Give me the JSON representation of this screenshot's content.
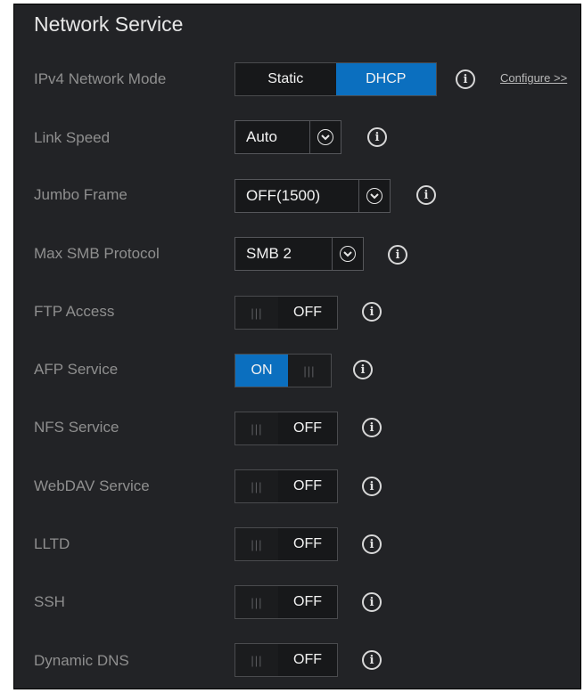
{
  "panel": {
    "title": "Network Service"
  },
  "ipv4": {
    "label": "IPv4 Network Mode",
    "options": [
      "Static",
      "DHCP"
    ],
    "selected": "DHCP",
    "configure_link": "Configure >>"
  },
  "link_speed": {
    "label": "Link Speed",
    "value": "Auto"
  },
  "jumbo_frame": {
    "label": "Jumbo Frame",
    "value": "OFF(1500)"
  },
  "max_smb": {
    "label": "Max SMB Protocol",
    "value": "SMB 2"
  },
  "toggles": [
    {
      "label": "FTP Access",
      "state": "OFF"
    },
    {
      "label": "AFP Service",
      "state": "ON"
    },
    {
      "label": "NFS Service",
      "state": "OFF"
    },
    {
      "label": "WebDAV Service",
      "state": "OFF"
    },
    {
      "label": "LLTD",
      "state": "OFF"
    },
    {
      "label": "SSH",
      "state": "OFF"
    },
    {
      "label": "Dynamic DNS",
      "state": "OFF"
    }
  ],
  "icons": {
    "info": "info-icon",
    "dropdown": "chevron-down-icon",
    "grip": "grip-icon"
  },
  "colors": {
    "panel_bg": "#222326",
    "accent": "#0b6fbf",
    "label": "#8f8f8f"
  }
}
